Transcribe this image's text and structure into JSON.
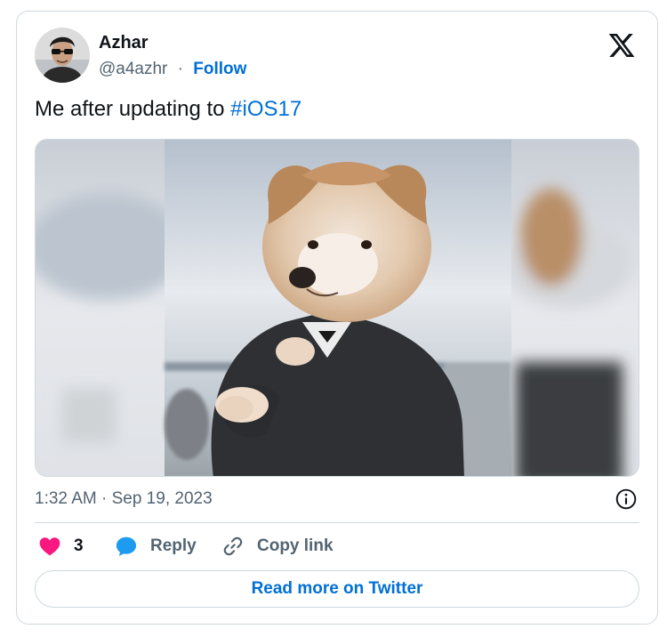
{
  "author": {
    "name": "Azhar",
    "handle": "@a4azhr",
    "separator": "·",
    "follow_label": "Follow",
    "avatar_icon": "user-avatar"
  },
  "brand": {
    "logo_icon": "x-logo-icon",
    "accent_color": "#006fd6",
    "like_color": "#f91880"
  },
  "tweet": {
    "text": "Me after updating to ",
    "hashtag": "#iOS17",
    "media_description_icon": "puppy-in-suit-image"
  },
  "meta": {
    "timestamp": "1:32 AM · Sep 19, 2023",
    "info_icon": "info-icon"
  },
  "actions": {
    "like_count": "3",
    "reply_label": "Reply",
    "copy_link_label": "Copy link"
  },
  "footer": {
    "read_more_label": "Read more on Twitter"
  }
}
